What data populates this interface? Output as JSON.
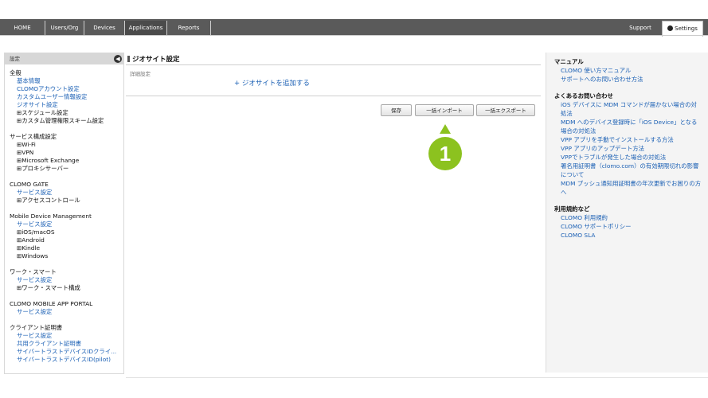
{
  "nav": {
    "tabs": [
      {
        "label": "HOME"
      },
      {
        "label": "Users/Org"
      },
      {
        "label": "Devices"
      },
      {
        "label": "Applications"
      },
      {
        "label": "Reports"
      }
    ],
    "support": "Support",
    "settings": "Settings"
  },
  "sidebar": {
    "header": "設定",
    "sections": [
      {
        "title": "全般",
        "items": [
          {
            "label": "基本情報",
            "kind": "link"
          },
          {
            "label": "CLOMOアカウント設定",
            "kind": "link"
          },
          {
            "label": "カスタムユーザー情報設定",
            "kind": "link"
          },
          {
            "label": "ジオサイト設定",
            "kind": "link"
          },
          {
            "label": "⊞スケジュール設定",
            "kind": "expand"
          },
          {
            "label": "⊞カスタム管理権限スキーム設定",
            "kind": "expand"
          }
        ]
      },
      {
        "title": "サービス構成設定",
        "items": [
          {
            "label": "⊞Wi-Fi",
            "kind": "expand"
          },
          {
            "label": "⊞VPN",
            "kind": "expand"
          },
          {
            "label": "⊞Microsoft Exchange",
            "kind": "expand"
          },
          {
            "label": "⊞プロキシサーバー",
            "kind": "expand"
          }
        ]
      },
      {
        "title": "CLOMO GATE",
        "items": [
          {
            "label": "サービス設定",
            "kind": "link"
          },
          {
            "label": "⊞アクセスコントロール",
            "kind": "expand"
          }
        ]
      },
      {
        "title": "Mobile Device Management",
        "items": [
          {
            "label": "サービス設定",
            "kind": "link"
          },
          {
            "label": "⊞iOS/macOS",
            "kind": "expand"
          },
          {
            "label": "⊞Android",
            "kind": "expand"
          },
          {
            "label": "⊞Kindle",
            "kind": "expand"
          },
          {
            "label": "⊞Windows",
            "kind": "expand"
          }
        ]
      },
      {
        "title": "ワーク・スマート",
        "items": [
          {
            "label": "サービス設定",
            "kind": "link"
          },
          {
            "label": "⊞ワーク・スマート構成",
            "kind": "expand"
          }
        ]
      },
      {
        "title": "CLOMO MOBILE APP PORTAL",
        "items": [
          {
            "label": "サービス設定",
            "kind": "link"
          }
        ]
      },
      {
        "title": "クライアント証明書",
        "items": [
          {
            "label": "サービス設定",
            "kind": "link"
          },
          {
            "label": "共用クライアント証明書",
            "kind": "link"
          },
          {
            "label": "サイバートラストデバイスIDクライ...",
            "kind": "link"
          },
          {
            "label": "サイバートラストデバイスID(pilot)",
            "kind": "link"
          }
        ]
      }
    ]
  },
  "main": {
    "title": "ジオサイト設定",
    "detail_label": "詳細設定",
    "add_geosite": "+ ジオサイトを追加する",
    "buttons": {
      "save": "保存",
      "bulk_import": "一括インポート",
      "bulk_export": "一括エクスポート"
    },
    "callout_number": "1"
  },
  "right_panel": {
    "sections": [
      {
        "title": "マニュアル",
        "links": [
          "CLOMO 使い方マニュアル",
          "サポートへのお問い合わせ方法"
        ]
      },
      {
        "title": "よくあるお問い合わせ",
        "links": [
          "iOS デバイスに MDM コマンドが届かない場合の対処法",
          "MDM へのデバイス登録時に「iOS Device」となる場合の対処法",
          "VPP アプリを手動でインストールする方法",
          "VPP アプリのアップデート方法",
          "VPPでトラブルが発生した場合の対処法",
          "署名用証明書（clomo.com）の有効期限切れの影響について",
          "MDM プッシュ通知用証明書の年次更新でお困りの方へ"
        ]
      },
      {
        "title": "利用規約など",
        "links": [
          "CLOMO 利用規約",
          "CLOMO サポートポリシー",
          "CLOMO SLA"
        ]
      }
    ]
  },
  "colors": {
    "link": "#1a5fb4",
    "callout": "#8cc21f",
    "topbar": "#5a5a5a"
  }
}
